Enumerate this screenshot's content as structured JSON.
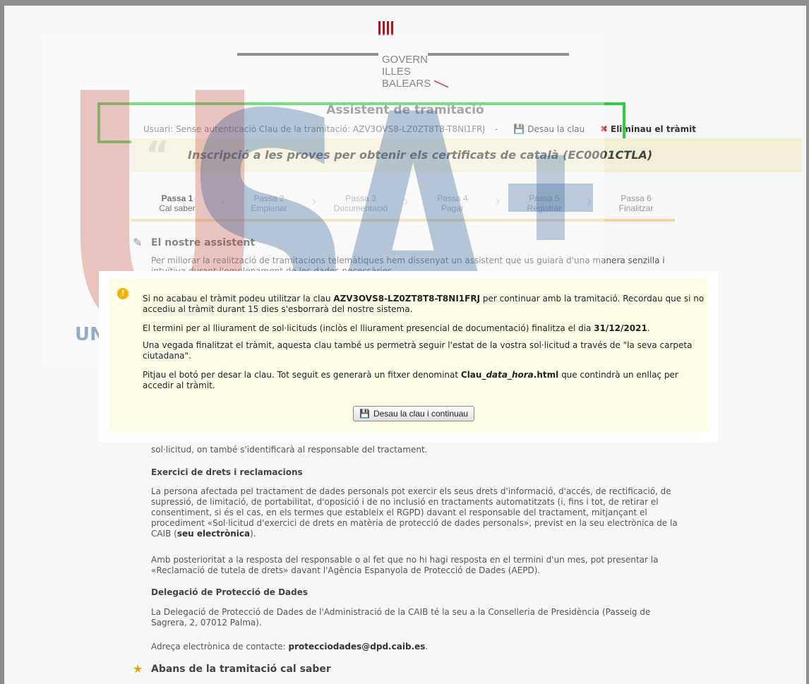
{
  "header": {
    "logo_lines": [
      "GOVERN",
      "ILLES",
      "BALEARS"
    ],
    "assistant_title": "Assistent de tramitació"
  },
  "userbar": {
    "text": "Usuari: Sense autenticació Clau de la tramitació: AZV3OVS8-LZ0ZT8T8-T8NI1FRJ",
    "separator": "-",
    "save_key": "Desau la clau",
    "delete": "Eliminau el tràmit",
    "save_icon": "floppy-icon",
    "delete_icon": "cross-icon"
  },
  "procedure": {
    "title": "Inscripció a les proves per obtenir els certificats de català (EC0001CTLA)"
  },
  "steps": [
    {
      "num": "Passa 1",
      "label": "Cal saber",
      "active": true
    },
    {
      "num": "Passa 2",
      "label": "Emplenar",
      "active": false
    },
    {
      "num": "Passa 3",
      "label": "Documentació",
      "active": false
    },
    {
      "num": "Passa 4",
      "label": "Pagar",
      "active": false
    },
    {
      "num": "Passa 5",
      "label": "Registrar",
      "active": false
    },
    {
      "num": "Passa 6",
      "label": "Finalitzar",
      "active": false
    }
  ],
  "content": {
    "assistant_heading": "El nostre assistent",
    "assistant_text_1": "Per millorar la realització de tramitacions telemàtiques hem dissenyat un assistent que us guiarà d'una manera senzilla i",
    "assistant_text_2": "intuïtiva durant l'emplenament de les dades necessàries.",
    "behind_text": "sol·licitud, on també s'identificarà al responsable del tractament.",
    "rights_heading": "Exercici de drets i reclamacions",
    "rights_p1": "La persona afectada pel tractament de dades personals pot exercir els seus drets d'informació, d'accés, de rectificació, de supressió, de limitació, de portabilitat, d'oposició i de no inclusió en tractaments automatitzats (i, fins i tot, de retirar el consentiment, si és el cas, en els termes que estableix el RGPD) davant el responsable del tractament, mitjançant el procediment «Sol·licitud d'exercici de drets en matèria de protecció de dades personals», previst en la seu electrònica de la CAIB (",
    "rights_p1_link": "seu electrònica",
    "rights_p1_end": ").",
    "rights_p2": "Amb posterioritat a la resposta del responsable o al fet que no hi hagi resposta en el termini d'un mes, pot presentar la «Reclamació de tutela de drets» davant l'Agència Espanyola de Protecció de Dades (AEPD).",
    "dpo_heading": "Delegació de Protecció de Dades",
    "dpo_p": "La Delegació de Protecció de Dades de l'Administració de la CAIB té la seu a la Conselleria de Presidència (Passeig de Sagrera, 2, 07012 Palma).",
    "contact_label": "Adreça electrònica de contacte: ",
    "contact_email": "protecciodades@dpd.caib.es",
    "contact_end": ".",
    "before_heading": "Abans de la tramitació cal saber"
  },
  "watermark": {
    "big_text": "USA",
    "sub_text": "UNIÓN SINDICAL Y TÉCNICOS SANITARIOS"
  },
  "modal": {
    "p1_a": "Si no acabau el tràmit podeu utilitzar la clau ",
    "p1_key": "AZV3OVS8-LZ0ZT8T8-T8NI1FRJ",
    "p1_b": " per continuar amb la tramitació. Recordau que si no accediu al tràmit durant 15 dies s'esborrarà del nostre sistema.",
    "p2_a": "El termini per al lliurament de sol·licituds (inclòs el lliurament presencial de documentació) finalitza el dia ",
    "p2_date": "31/12/2021",
    "p2_b": ".",
    "p3": "Una vegada finalitzat el tràmit, aquesta clau també us permetrà seguir l'estat de la vostra sol·licitud a través de \"la seva carpeta ciutadana\".",
    "p4_a": "Pitjau el botó per desar la clau. Tot seguit es generarà un fitxer denominat ",
    "p4_file_a": "Clau_",
    "p4_file_b": "data_hora",
    "p4_file_c": ".html",
    "p4_b": " que contindrà un enllaç per accedir al tràmit.",
    "button": "Desau la clau i continuau"
  }
}
